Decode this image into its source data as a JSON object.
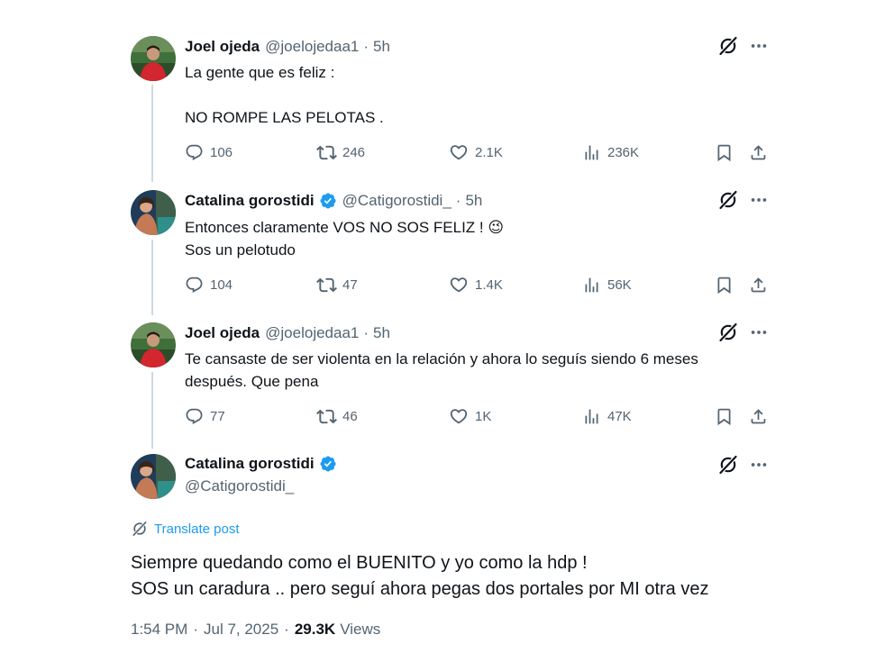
{
  "colors": {
    "accent": "#1d9bf0",
    "text_primary": "#0f1419",
    "text_secondary": "#536471",
    "thread_line": "#cfd9de"
  },
  "tweets": [
    {
      "name": "Joel ojeda",
      "verified": false,
      "handle": "@joelojedaa1",
      "separator": "·",
      "time": "5h",
      "text": "La gente que es feliz :\n\nNO ROMPE LAS PELOTAS .",
      "replies": "106",
      "retweets": "246",
      "likes": "2.1K",
      "views": "236K"
    },
    {
      "name": "Catalina gorostidi",
      "verified": true,
      "handle": "@Catigorostidi_",
      "separator": "·",
      "time": "5h",
      "text": "Entonces claramente VOS NO SOS FELIZ ! 😉\nSos un pelotudo",
      "replies": "104",
      "retweets": "47",
      "likes": "1.4K",
      "views": "56K"
    },
    {
      "name": "Joel ojeda",
      "verified": false,
      "handle": "@joelojedaa1",
      "separator": "·",
      "time": "5h",
      "text": "Te cansaste de ser violenta en la relación y ahora lo seguís siendo 6 meses\ndespués. Que pena",
      "replies": "77",
      "retweets": "46",
      "likes": "1K",
      "views": "47K"
    }
  ],
  "main_tweet": {
    "name": "Catalina gorostidi",
    "verified": true,
    "handle": "@Catigorostidi_",
    "translate_label": "Translate post",
    "text": "Siempre quedando como el BUENITO y yo como la hdp !\nSOS un caradura .. pero seguí ahora pegas dos portales por MI otra vez",
    "time": "1:54 PM",
    "date": "Jul 7, 2025",
    "separator": "·",
    "views_count": "29.3K",
    "views_label": "Views"
  },
  "icons": {
    "grok": "grok-icon",
    "more": "more-icon",
    "reply": "reply-icon",
    "retweet": "retweet-icon",
    "like": "heart-icon",
    "views": "views-icon",
    "bookmark": "bookmark-icon",
    "share": "share-icon",
    "verified": "verified-badge-icon",
    "translate": "translate-icon"
  }
}
